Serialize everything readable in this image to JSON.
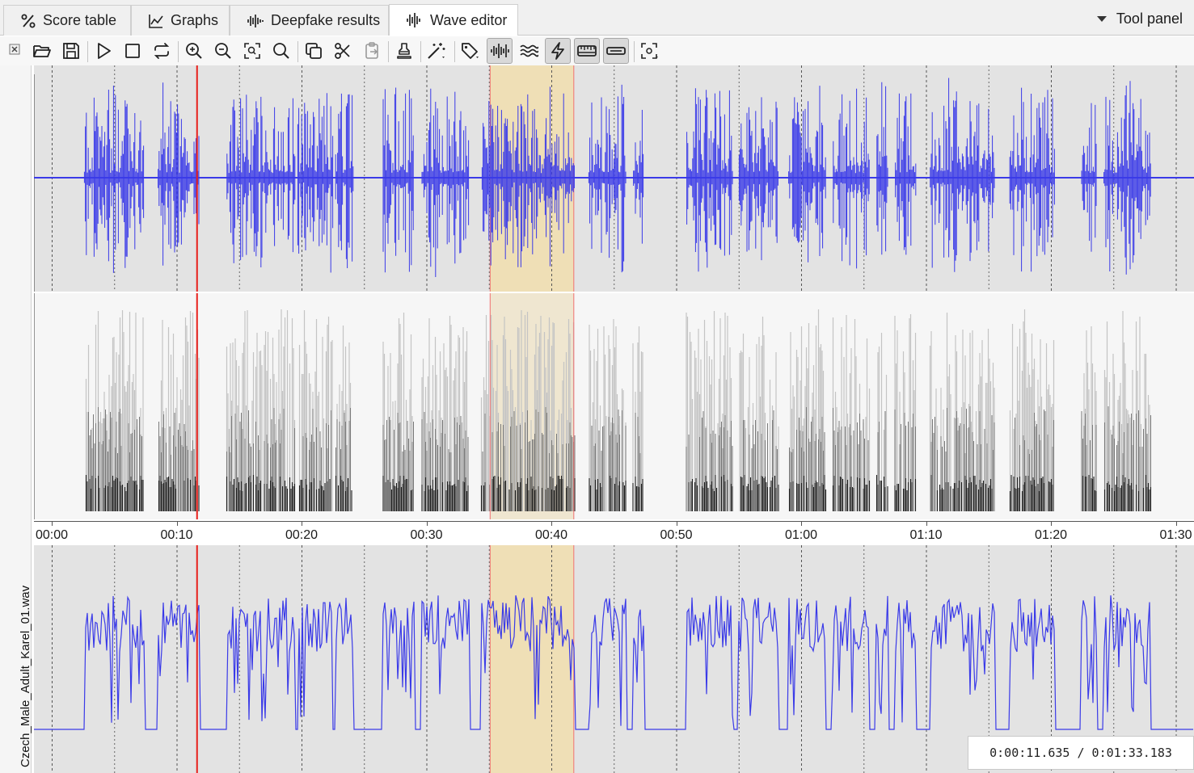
{
  "tabs": [
    {
      "label": "Score table",
      "icon": "percent-icon"
    },
    {
      "label": "Graphs",
      "icon": "line-chart-icon"
    },
    {
      "label": "Deepfake results",
      "icon": "waveform-icon"
    },
    {
      "label": "Wave editor",
      "icon": "waveform-icon"
    }
  ],
  "active_tab": "Wave editor",
  "tool_panel_label": "Tool panel",
  "toolbar_icons": [
    "open-folder-icon",
    "save-icon",
    "play-icon",
    "stop-icon",
    "loop-icon",
    "zoom-in-icon",
    "zoom-out-icon",
    "zoom-selection-icon",
    "zoom-fit-icon",
    "copy-icon",
    "cut-icon",
    "paste-icon",
    "stamp-icon",
    "magic-wand-icon",
    "tag-icon",
    "waveform-view-icon",
    "spectrum-view-icon",
    "flash-icon",
    "ruler-icon",
    "bar-icon",
    "screenshot-icon"
  ],
  "file_name": "Czech_Male_Adult_Karel_01.wav",
  "timeline": {
    "tick_labels": [
      "00:00",
      "00:10",
      "00:20",
      "00:30",
      "00:40",
      "00:50",
      "01:00",
      "01:10",
      "01:20",
      "01:30"
    ],
    "tick_seconds": [
      0,
      10,
      20,
      30,
      40,
      50,
      60,
      70,
      80,
      90
    ],
    "total_seconds": 93.183,
    "cursor_seconds": 11.635,
    "selection_seconds": [
      35.1,
      41.8
    ]
  },
  "time_readout": "0:00:11.635 / 0:01:33.183",
  "colors": {
    "wave": "#3a3ae8",
    "cursor": "#e8201c",
    "selection": "#efdfb6",
    "panel_bg": "#e3e3e3"
  }
}
